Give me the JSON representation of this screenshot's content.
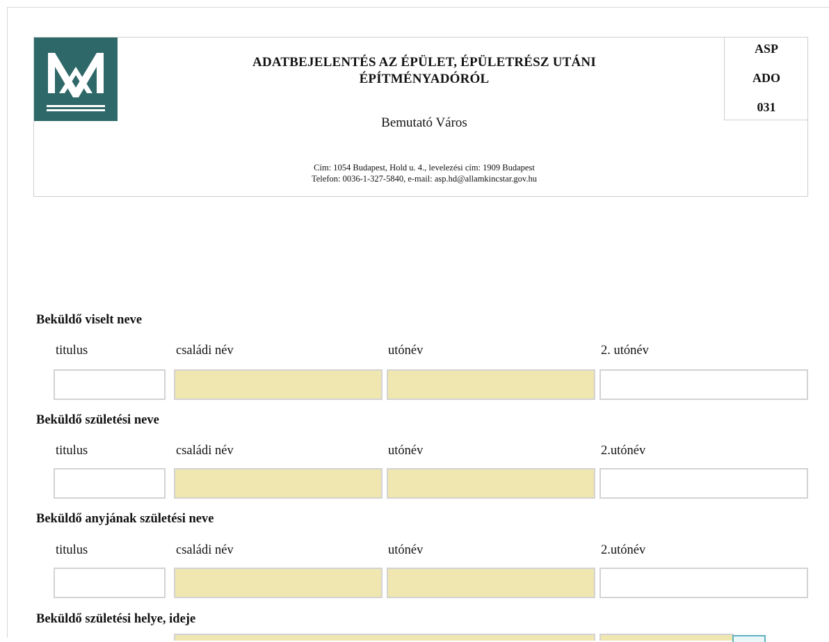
{
  "header": {
    "title_line1": "ADATBEJELENTÉS AZ ÉPÜLET, ÉPÜLETRÉSZ UTÁNI",
    "title_line2": "ÉPÍTMÉNYADÓRÓL",
    "city": "Bemutató Város",
    "address_line1": "Cím: 1054 Budapest, Hold u. 4., levelezési cím: 1909 Budapest",
    "address_line2": "Telefon: 0036-1-327-5840, e-mail: asp.hd@allamkincstar.gov.hu",
    "code": [
      "ASP",
      "ADO",
      "031"
    ]
  },
  "colors": {
    "logo_bg": "#2e6868",
    "required_field": "#efe6b0",
    "field_border": "#d3d3d3"
  },
  "sections": [
    {
      "title": "Beküldő viselt neve",
      "labels": [
        "titulus",
        "családi név",
        "utónév",
        "2. utónév"
      ],
      "values": [
        "",
        "",
        "",
        ""
      ]
    },
    {
      "title": "Beküldő születési neve",
      "labels": [
        "titulus",
        "családi név",
        "utónév",
        "2.utónév"
      ],
      "values": [
        "",
        "",
        "",
        ""
      ]
    },
    {
      "title": "Beküldő anyjának születési neve",
      "labels": [
        "titulus",
        "családi név",
        "utónév",
        "2.utónév"
      ],
      "values": [
        "",
        "",
        "",
        ""
      ]
    },
    {
      "title": "Beküldő születési helye, ideje"
    }
  ],
  "icons": {
    "logo": "hungarian-state-treasury-logo",
    "calendar": "calendar-button"
  }
}
